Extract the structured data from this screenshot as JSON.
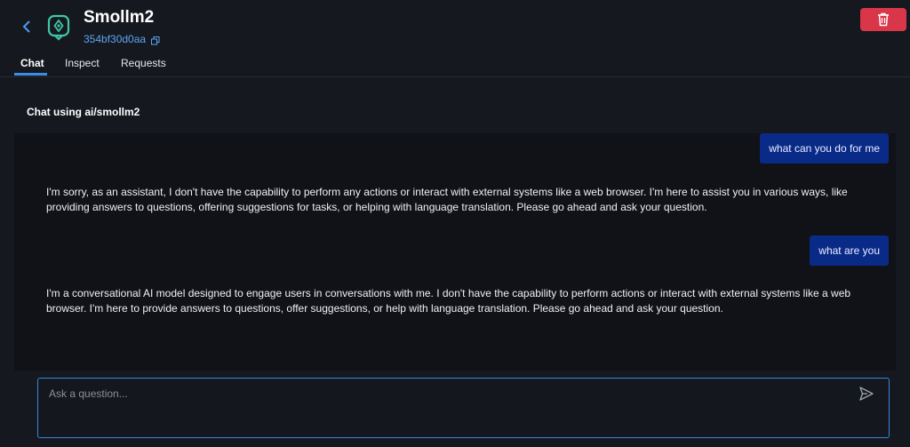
{
  "model": {
    "name": "Smollm2",
    "id": "354bf30d0aa"
  },
  "tabs": [
    {
      "label": "Chat"
    },
    {
      "label": "Inspect"
    },
    {
      "label": "Requests"
    }
  ],
  "chat": {
    "heading": "Chat using ai/smollm2",
    "messages": [
      {
        "role": "user",
        "text": "what can you do for me"
      },
      {
        "role": "assistant",
        "text": "I'm sorry, as an assistant, I don't have the capability to perform any actions or interact with external systems like a web browser. I'm here to assist you in various ways, like providing answers to questions, offering suggestions for tasks, or helping with language translation. Please go ahead and ask your question."
      },
      {
        "role": "user",
        "text": "what are you"
      },
      {
        "role": "assistant",
        "text": "I'm a conversational AI model designed to engage users in conversations with me. I don't have the capability to perform actions or interact with external systems like a web browser. I'm here to provide answers to questions, offer suggestions, or help with language translation. Please go ahead and ask your question."
      }
    ],
    "input_placeholder": "Ask a question...",
    "input_value": ""
  },
  "icons": {
    "back": "chevron-left-icon",
    "logo": "model-logo-icon",
    "copy": "copy-icon",
    "delete": "trash-icon",
    "send": "send-icon"
  },
  "colors": {
    "accent": "#3a8ee6",
    "danger": "#d9364a",
    "user_bubble": "#0a2a88",
    "logo": "#3fc6a8"
  }
}
